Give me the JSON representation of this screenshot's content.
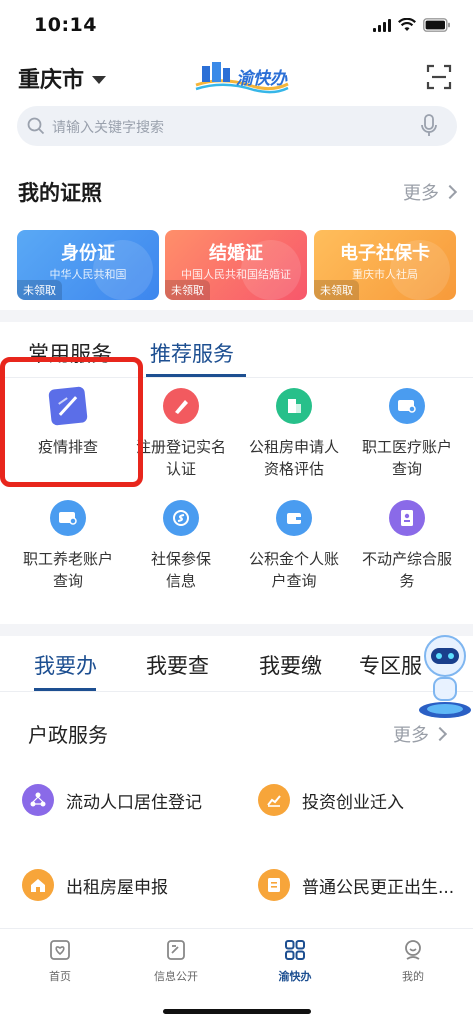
{
  "status": {
    "time": "10:14"
  },
  "header": {
    "city": "重庆市",
    "logo_text": "渝快办"
  },
  "search": {
    "placeholder": "请输入关键字搜索"
  },
  "certificates": {
    "title": "我的证照",
    "more": "更多",
    "cards": [
      {
        "name": "身份证",
        "issuer": "中华人民共和国",
        "state": "未领取"
      },
      {
        "name": "结婚证",
        "issuer": "中国人民共和国结婚证",
        "state": "未领取"
      },
      {
        "name": "电子社保卡",
        "issuer": "重庆市人社局",
        "state": "未领取"
      }
    ]
  },
  "services": {
    "tabs": [
      "常用服务",
      "推荐服务"
    ],
    "active_tab": "推荐服务",
    "items": [
      {
        "label": "疫情排查",
        "icon": "map-icon",
        "color": "#5b6ee8"
      },
      {
        "label": "注册登记实名认证",
        "icon": "pen-icon",
        "color": "#f25a5f"
      },
      {
        "label": "公租房申请人资格评估",
        "icon": "building-icon",
        "color": "#27c08a"
      },
      {
        "label": "职工医疗账户查询",
        "icon": "id-card-search-icon",
        "color": "#4a9cf0"
      },
      {
        "label": "职工养老账户查询",
        "icon": "id-card-search-icon",
        "color": "#4a9cf0"
      },
      {
        "label": "社保参保信息",
        "icon": "social-security-icon",
        "color": "#4a9cf0"
      },
      {
        "label": "公积金个人账户查询",
        "icon": "wallet-icon",
        "color": "#4a9cf0"
      },
      {
        "label": "不动产综合服务",
        "icon": "property-doc-icon",
        "color": "#8a6ae8"
      }
    ]
  },
  "tasks": {
    "tabs": [
      "我要办",
      "我要查",
      "我要缴",
      "专区服"
    ],
    "active_tab": "我要办",
    "section_title": "户政服务",
    "more": "更多",
    "items": [
      {
        "label": "流动人口居住登记",
        "icon": "people-network-icon",
        "color": "#8a6ae8"
      },
      {
        "label": "投资创业迁入",
        "icon": "chart-icon",
        "color": "#f7a53a"
      },
      {
        "label": "出租房屋申报",
        "icon": "house-icon",
        "color": "#f7a53a"
      },
      {
        "label": "普通公民更正出生...",
        "icon": "document-icon",
        "color": "#f7a53a"
      }
    ]
  },
  "bottom_nav": [
    {
      "label": "首页",
      "icon": "home-icon"
    },
    {
      "label": "信息公开",
      "icon": "info-doc-icon"
    },
    {
      "label": "渝快办",
      "icon": "grid-icon"
    },
    {
      "label": "我的",
      "icon": "profile-icon"
    }
  ],
  "colors": {
    "brand": "#1d4f91",
    "highlight": "#e8261c"
  }
}
